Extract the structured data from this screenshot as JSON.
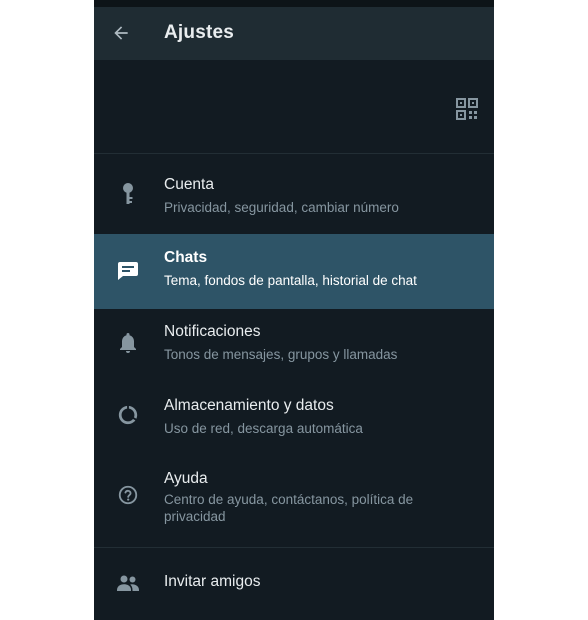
{
  "header": {
    "title": "Ajustes"
  },
  "icons": {
    "back": "arrow-left-icon",
    "qr": "qr-code-icon"
  },
  "menu": [
    {
      "id": "cuenta",
      "icon": "key-icon",
      "label": "Cuenta",
      "sub": "Privacidad, seguridad, cambiar número",
      "selected": false
    },
    {
      "id": "chats",
      "icon": "chat-icon",
      "label": "Chats",
      "sub": "Tema, fondos de pantalla, historial de chat",
      "selected": true
    },
    {
      "id": "notificaciones",
      "icon": "bell-icon",
      "label": "Notificaciones",
      "sub": "Tonos de mensajes, grupos y llamadas",
      "selected": false
    },
    {
      "id": "almacenamiento",
      "icon": "data-usage-icon",
      "label": "Almacenamiento y datos",
      "sub": "Uso de red, descarga automática",
      "selected": false
    },
    {
      "id": "ayuda",
      "icon": "help-icon",
      "label": "Ayuda",
      "sub": "Centro de ayuda, contáctanos, política de privacidad",
      "selected": false
    },
    {
      "id": "invitar",
      "icon": "people-icon",
      "label": "Invitar amigos",
      "sub": "",
      "selected": false
    }
  ],
  "colors": {
    "background": "#121b22",
    "appbar": "#1f2c33",
    "selected": "#2e5467",
    "icon": "#8696a0",
    "text": "#e9edef",
    "subtext": "#8696a0"
  }
}
